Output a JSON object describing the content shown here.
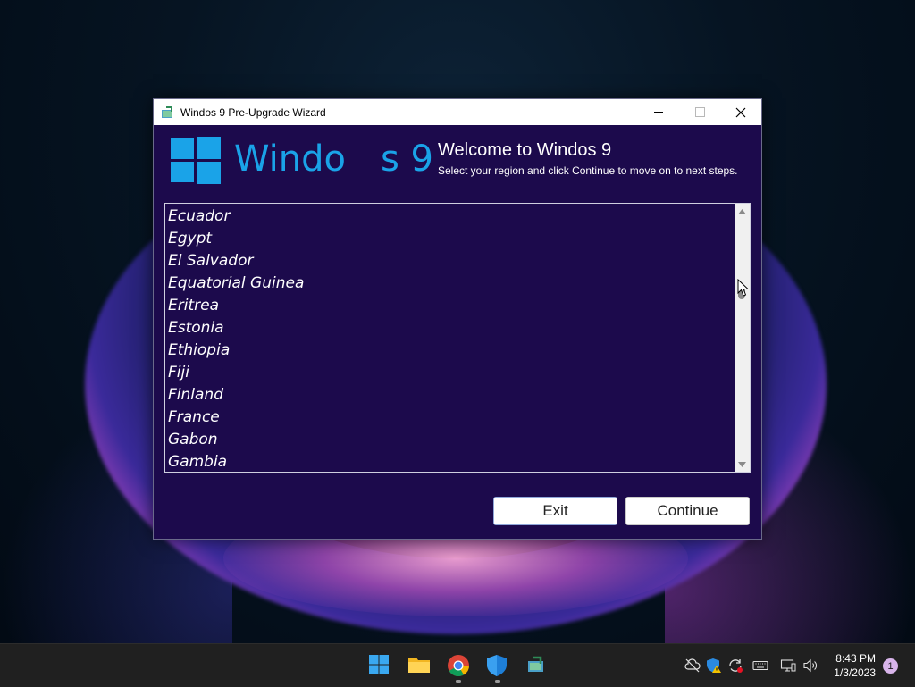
{
  "window": {
    "title": "Windos 9 Pre-Upgrade Wizard",
    "icon": "wizard-app-icon"
  },
  "banner": {
    "logo_text_left": "Windo",
    "logo_text_right": "s 9",
    "welcome_title": "Welcome to Windos 9",
    "welcome_subtitle": "Select your region and click Continue to move on to next steps."
  },
  "regions": {
    "items": [
      "Ecuador",
      "Egypt",
      "El Salvador",
      "Equatorial Guinea",
      "Eritrea",
      "Estonia",
      "Ethiopia",
      "Fiji",
      "Finland",
      "France",
      "Gabon",
      "Gambia"
    ],
    "scroll_position": 0.3
  },
  "buttons": {
    "exit": "Exit",
    "continue": "Continue"
  },
  "taskbar": {
    "apps": [
      "start-icon",
      "file-explorer-icon",
      "chrome-icon",
      "security-shield-icon",
      "wizard-app-icon"
    ],
    "time": "8:43 PM",
    "date": "1/3/2023",
    "notification_count": "1"
  },
  "colors": {
    "window_bg": "#1c0a4c",
    "accent": "#1aa3e8"
  }
}
